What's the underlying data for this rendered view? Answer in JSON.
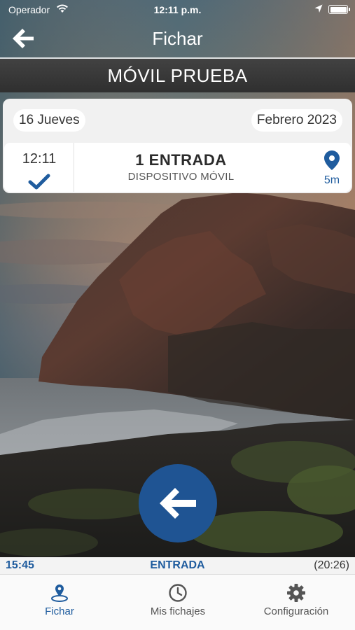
{
  "status_bar": {
    "carrier": "Operador",
    "time": "12:11 p.m."
  },
  "header": {
    "title": "Fichar",
    "company": "MÓVIL PRUEBA"
  },
  "card": {
    "day": "16 Jueves",
    "month": "Febrero 2023",
    "entry": {
      "time": "12:11",
      "type": "1  ENTRADA",
      "device": "DISPOSITIVO MÓVIL",
      "distance": "5m"
    }
  },
  "info_bar": {
    "time": "15:45",
    "status": "ENTRADA",
    "duration": "(20:26)"
  },
  "tabs": [
    {
      "label": "Fichar",
      "icon": "location-pin-icon",
      "active": true
    },
    {
      "label": "Mis fichajes",
      "icon": "clock-icon",
      "active": false
    },
    {
      "label": "Configuración",
      "icon": "gear-icon",
      "active": false
    }
  ],
  "colors": {
    "accent": "#1f5493",
    "accent_text": "#1f5c9e"
  }
}
